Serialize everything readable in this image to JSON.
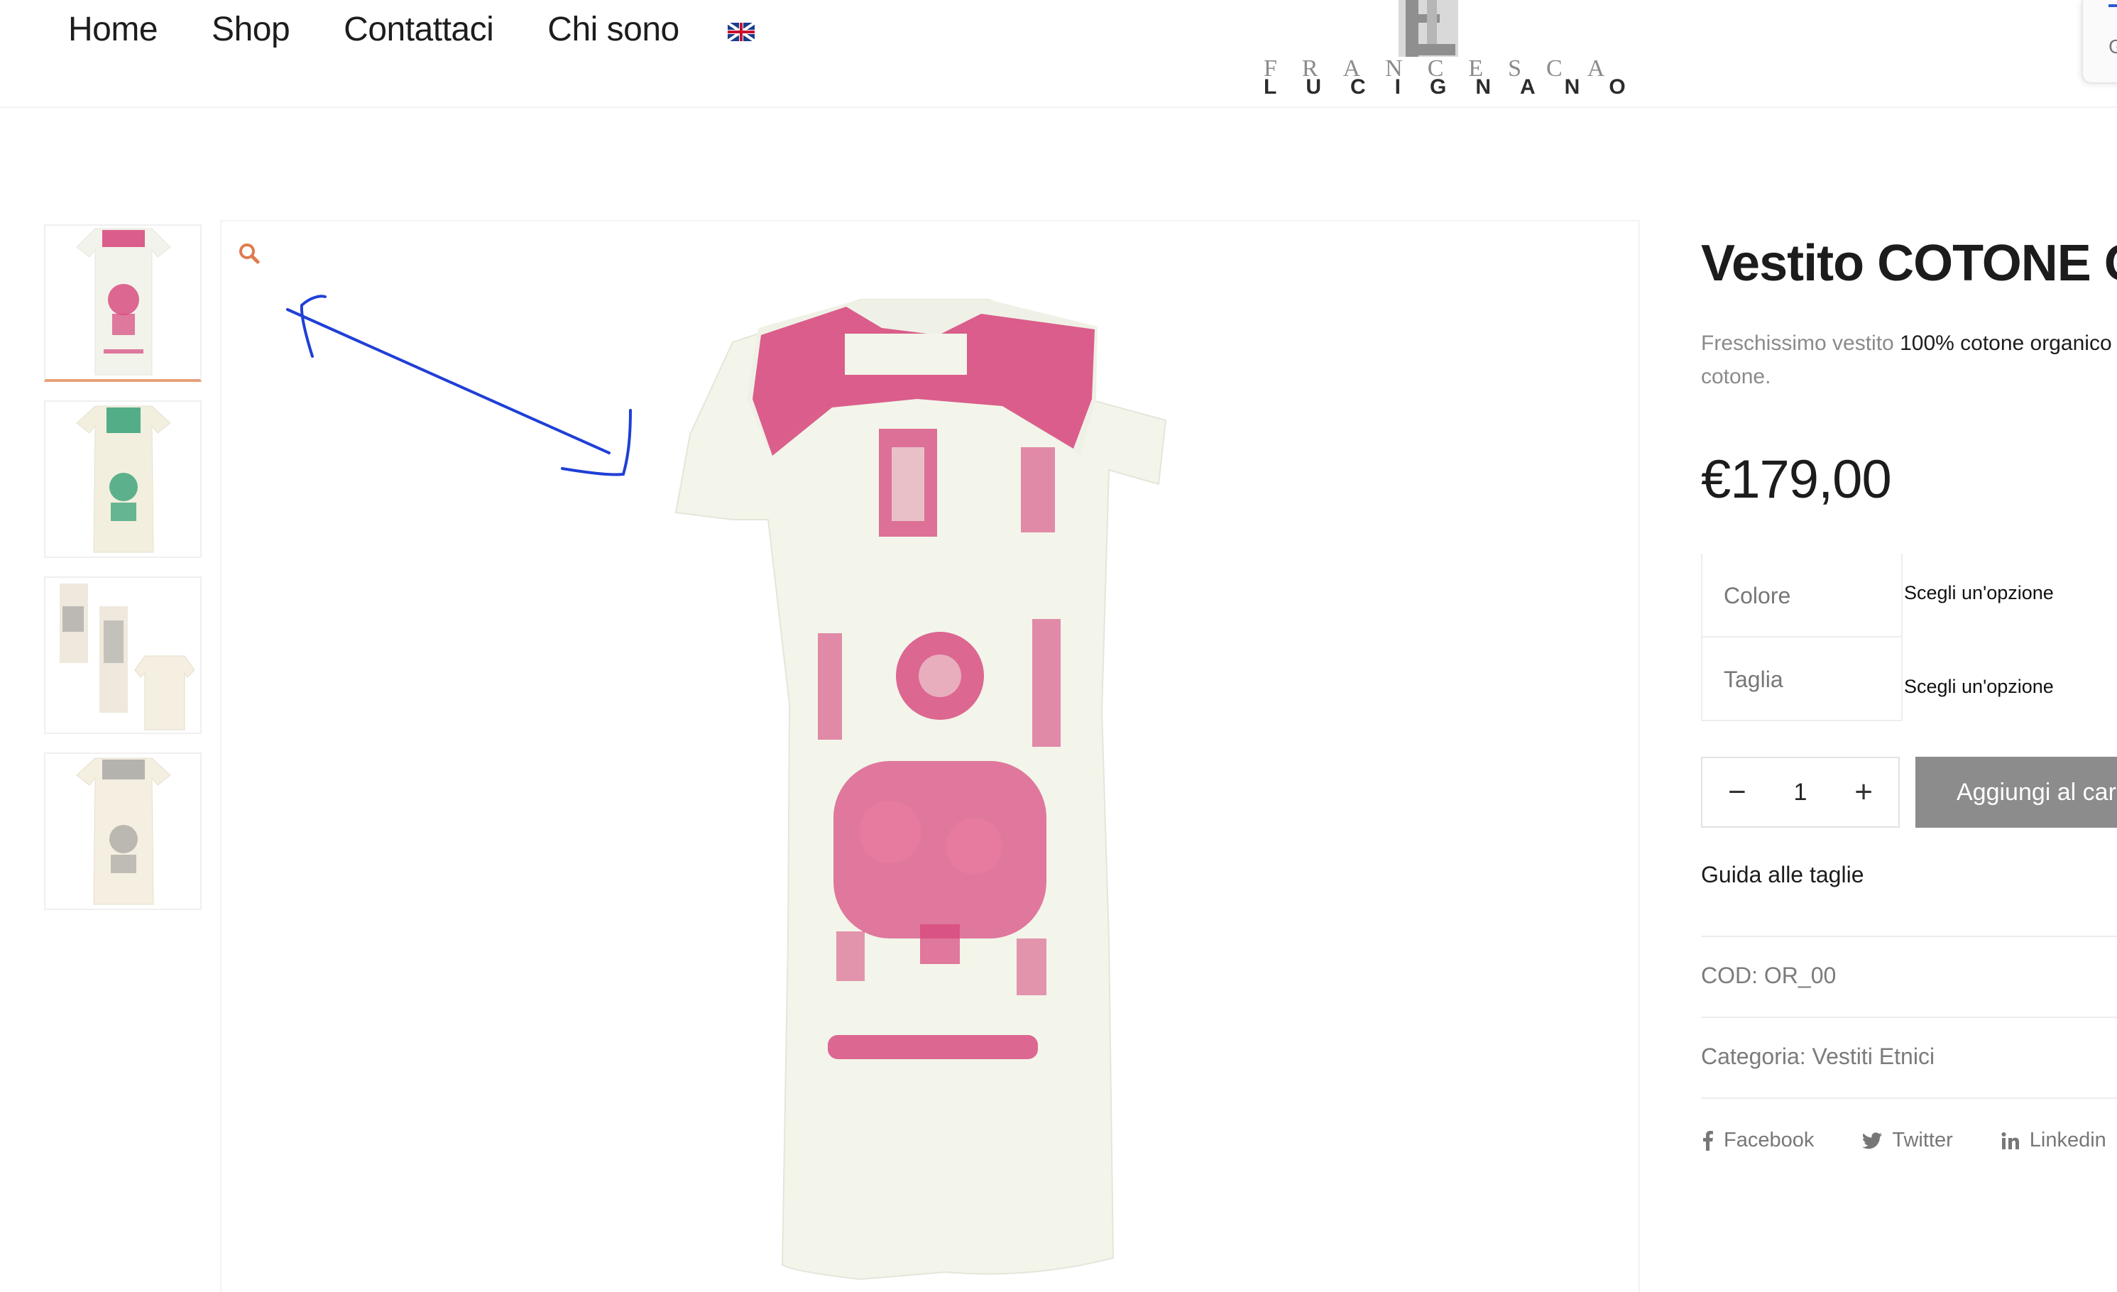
{
  "nav": {
    "items": [
      "Home",
      "Shop",
      "Contattaci",
      "Chi sono"
    ],
    "language_flag": "uk-flag-icon"
  },
  "logo": {
    "top_line": "FRANCESCA",
    "bottom_line": "LUCIGNANO",
    "monogram": "FL"
  },
  "side_popup": {
    "letter": "G"
  },
  "gallery": {
    "thumbnails": [
      "pink-embroidered-dress",
      "green-embroidered-dress",
      "grey-dress-set",
      "grey-embroidered-dress"
    ],
    "active_index": 0,
    "zoom_icon": "search-icon"
  },
  "product": {
    "title": "Vestito COTONE OR",
    "description_prefix": "Freschissimo vestito ",
    "description_bold": "100% cotone organico",
    "description_suffix": " c",
    "description_line2": "cotone.",
    "price": "€179,00",
    "variations": [
      {
        "label": "Colore",
        "value": "Scegli un'opzione"
      },
      {
        "label": "Taglia",
        "value": "Scegli un'opzione"
      }
    ],
    "quantity": "1",
    "minus_label": "−",
    "plus_label": "+",
    "add_to_cart": "Aggiungi al carrello",
    "size_guide": "Guida alle taglie",
    "sku": "COD: OR_00",
    "category": "Categoria: Vestiti Etnici",
    "share": [
      "Facebook",
      "Twitter",
      "Linkedin"
    ]
  },
  "colors": {
    "accent": "#e07b4d",
    "embroidery_pink": "#d6437a",
    "dress_cream": "#f4f4ea",
    "button_grey": "#8c8c8c",
    "annotation_blue": "#1f3fd6"
  }
}
